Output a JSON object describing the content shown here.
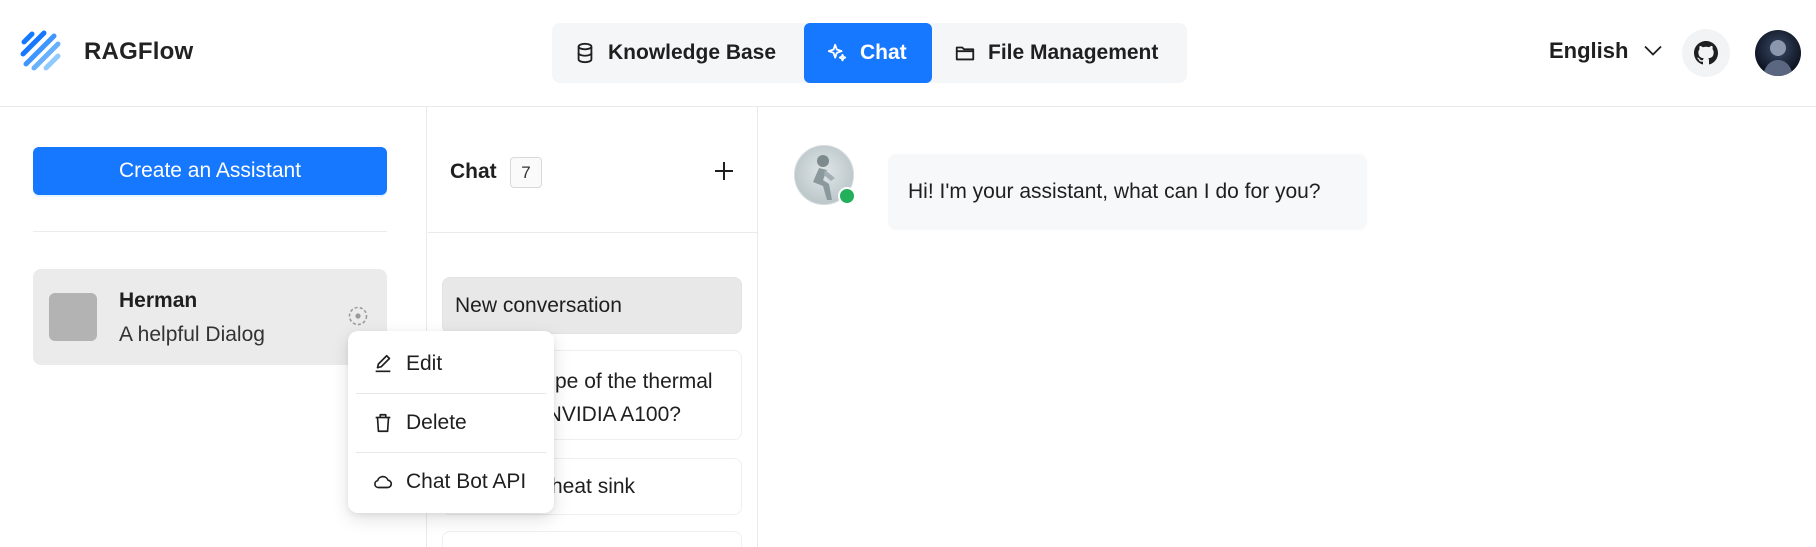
{
  "app": {
    "brand": "RAGFlow"
  },
  "nav": {
    "tabs": [
      {
        "label": "Knowledge Base",
        "icon": "database-icon",
        "active": false
      },
      {
        "label": "Chat",
        "icon": "sparkle-icon",
        "active": true
      },
      {
        "label": "File Management",
        "icon": "folder-icon",
        "active": false
      }
    ]
  },
  "header": {
    "language": "English"
  },
  "sidebar": {
    "create_label": "Create an Assistant",
    "assistants": [
      {
        "name": "Herman",
        "description": "A helpful Dialog"
      }
    ]
  },
  "context_menu": {
    "items": [
      {
        "label": "Edit",
        "icon": "edit-icon"
      },
      {
        "label": "Delete",
        "icon": "trash-icon"
      },
      {
        "label": "Chat Bot API",
        "icon": "cloud-icon"
      }
    ]
  },
  "conversations": {
    "title": "Chat",
    "count": "7",
    "items": [
      {
        "label": "New conversation"
      },
      {
        "line1": "pe of the thermal",
        "line2": "f NVIDIA A100?"
      },
      {
        "label": "heat sink"
      }
    ]
  },
  "chat": {
    "greeting": "Hi! I'm your assistant, what can I do for you?"
  },
  "colors": {
    "primary": "#1677ff",
    "online": "#22b05b"
  }
}
